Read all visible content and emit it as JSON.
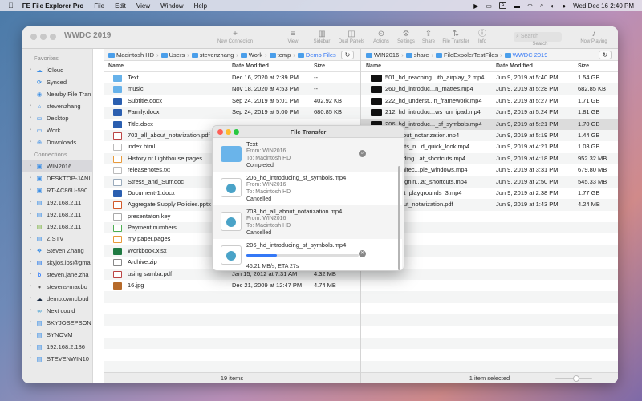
{
  "menubar": {
    "apple": "",
    "items": [
      "FE File Explorer Pro",
      "File",
      "Edit",
      "View",
      "Window",
      "Help"
    ],
    "input_badge": "A",
    "clock": "Wed Dec 16  2:40 PM"
  },
  "window": {
    "title": "WWDC 2019",
    "toolbar": [
      {
        "icon": "+",
        "label": "New Connection"
      },
      {
        "icon": "≡",
        "label": "View"
      },
      {
        "icon": "▥",
        "label": "Sidebar"
      },
      {
        "icon": "◫",
        "label": "Dual Panels"
      },
      {
        "icon": "⊙",
        "label": "Actions"
      },
      {
        "icon": "⚙",
        "label": "Settings"
      },
      {
        "icon": "⇪",
        "label": "Share"
      },
      {
        "icon": "⇅",
        "label": "File Transfer"
      },
      {
        "icon": "ⓘ",
        "label": "Info"
      },
      {
        "icon": "⌕",
        "label": "Search"
      },
      {
        "icon": "♪",
        "label": "Now Playing"
      }
    ],
    "search_placeholder": "Search"
  },
  "sidebar": {
    "favorites_header": "Favorites",
    "favorites": [
      {
        "label": "iCloud",
        "icon": "☁",
        "color": "#3a8ee6",
        "arrow": true
      },
      {
        "label": "Synced",
        "icon": "⟳",
        "color": "#3a8ee6",
        "arrow": false
      },
      {
        "label": "Nearby File Tran",
        "icon": "◉",
        "color": "#3a8ee6",
        "arrow": false
      },
      {
        "label": "stevenzhang",
        "icon": "⌂",
        "color": "#3a8ee6",
        "arrow": true
      },
      {
        "label": "Desktop",
        "icon": "▭",
        "color": "#3a8ee6",
        "arrow": true
      },
      {
        "label": "Work",
        "icon": "▭",
        "color": "#3a8ee6",
        "arrow": true
      },
      {
        "label": "Downloads",
        "icon": "⊕",
        "color": "#3a8ee6",
        "arrow": true
      }
    ],
    "connections_header": "Connections",
    "connections": [
      {
        "label": "WIN2016",
        "icon": "▣",
        "color": "#3a8ee6",
        "selected": true
      },
      {
        "label": "DESKTOP-JANI",
        "icon": "▣",
        "color": "#3a8ee6"
      },
      {
        "label": "RT-AC86U-590",
        "icon": "▣",
        "color": "#3a8ee6"
      },
      {
        "label": "192.168.2.11",
        "icon": "▤",
        "color": "#3a8ee6"
      },
      {
        "label": "192.168.2.11",
        "icon": "▤",
        "color": "#3a8ee6"
      },
      {
        "label": "192.168.2.11",
        "icon": "▤",
        "color": "#7cb342"
      },
      {
        "label": "Z STV",
        "icon": "▤",
        "color": "#3a8ee6"
      },
      {
        "label": "Steven Zhang",
        "icon": "❖",
        "color": "#3a8ee6"
      },
      {
        "label": "skyjos.ios@gma",
        "icon": "▤",
        "color": "#1a73e8"
      },
      {
        "label": "steven.jane.zha",
        "icon": "b",
        "color": "#0061fe"
      },
      {
        "label": "stevens-macbo",
        "icon": "●",
        "color": "#555"
      },
      {
        "label": "demo.owncloud",
        "icon": "☁",
        "color": "#1d2d44"
      },
      {
        "label": "Next could",
        "icon": "∞",
        "color": "#0082c9"
      },
      {
        "label": "SKYJOSEPSON",
        "icon": "▤",
        "color": "#3a8ee6"
      },
      {
        "label": "SYNOVM",
        "icon": "▤",
        "color": "#3a8ee6"
      },
      {
        "label": "192.168.2.186",
        "icon": "▤",
        "color": "#3a8ee6"
      },
      {
        "label": "STEVENWIN10",
        "icon": "▤",
        "color": "#3a8ee6"
      }
    ]
  },
  "left_pane": {
    "breadcrumb": [
      "Macintosh HD",
      "Users",
      "stevenzhang",
      "Work",
      "temp",
      "Demo Files"
    ],
    "columns": {
      "name": "Name",
      "date": "Date Modified",
      "size": "Size"
    },
    "rows": [
      {
        "name": "Text",
        "date": "Dec 16, 2020 at 2:39 PM",
        "size": "--",
        "icon": "folder"
      },
      {
        "name": "music",
        "date": "Nov 18, 2020 at 4:53 PM",
        "size": "--",
        "icon": "folder"
      },
      {
        "name": "Subtitle.docx",
        "date": "Sep 24, 2019 at 5:01 PM",
        "size": "402.92 KB",
        "icon": "word"
      },
      {
        "name": "Family.docx",
        "date": "Sep 24, 2019 at 5:00 PM",
        "size": "680.85 KB",
        "icon": "word"
      },
      {
        "name": "Title.docx",
        "date": "",
        "size": "",
        "icon": "word"
      },
      {
        "name": "703_all_about_notarization.pdf",
        "date": "",
        "size": "",
        "icon": "pdf"
      },
      {
        "name": "index.html",
        "date": "",
        "size": "",
        "icon": "gen"
      },
      {
        "name": "History of Lighthouse.pages",
        "date": "",
        "size": "",
        "icon": "pages"
      },
      {
        "name": "releasenotes.txt",
        "date": "",
        "size": "",
        "icon": "gen"
      },
      {
        "name": "Stress_and_Surr.doc",
        "date": "",
        "size": "",
        "icon": "doc"
      },
      {
        "name": "Document-1.docx",
        "date": "",
        "size": "",
        "icon": "word"
      },
      {
        "name": "Aggregate Supply Policies.pptx",
        "date": "",
        "size": "",
        "icon": "pptx"
      },
      {
        "name": "presentaton.key",
        "date": "",
        "size": "",
        "icon": "key"
      },
      {
        "name": "Payment.numbers",
        "date": "",
        "size": "",
        "icon": "num"
      },
      {
        "name": "my paper.pages",
        "date": "",
        "size": "",
        "icon": "pages"
      },
      {
        "name": "Workbook.xlsx",
        "date": "",
        "size": "",
        "icon": "excel"
      },
      {
        "name": "Archive.zip",
        "date": "",
        "size": "",
        "icon": "zip"
      },
      {
        "name": "using samba.pdf",
        "date": "Jan 15, 2012 at 7:31 AM",
        "size": "4.32 MB",
        "icon": "pdf"
      },
      {
        "name": "16.jpg",
        "date": "Dec 21, 2009 at 12:47 PM",
        "size": "4.74 MB",
        "icon": "img"
      }
    ],
    "status": "19 items"
  },
  "right_pane": {
    "breadcrumb": [
      "WIN2016",
      "share",
      "FileExpolerTestFiles",
      "WWDC 2019"
    ],
    "columns": {
      "name": "Name",
      "date": "Date Modified",
      "size": "Size"
    },
    "rows": [
      {
        "name": "501_hd_reaching...ith_airplay_2.mp4",
        "date": "Jun 9, 2019 at 5:40 PM",
        "size": "1.54 GB",
        "icon": "vid"
      },
      {
        "name": "260_hd_introduc...n_mattes.mp4",
        "date": "Jun 9, 2019 at 5:28 PM",
        "size": "682.85 KB",
        "icon": "vid"
      },
      {
        "name": "222_hd_underst...n_framework.mp4",
        "date": "Jun 9, 2019 at 5:27 PM",
        "size": "1.71 GB",
        "icon": "vid"
      },
      {
        "name": "212_hd_introduc...ws_on_ipad.mp4",
        "date": "Jun 9, 2019 at 5:24 PM",
        "size": "1.81 GB",
        "icon": "vid"
      },
      {
        "name": "206_hd_introduc..._sf_symbols.mp4",
        "date": "Jun 9, 2019 at 5:21 PM",
        "size": "1.70 GB",
        "icon": "vid",
        "selected": true
      },
      {
        "name": "...ll_about_notarization.mp4",
        "date": "Jun 9, 2019 at 5:19 PM",
        "size": "1.44 GB",
        "icon": "vid"
      },
      {
        "name": "..._whats_n...d_quick_look.mp4",
        "date": "Jun 9, 2019 at 4:21 PM",
        "size": "1.03 GB",
        "icon": "vid"
      },
      {
        "name": "..._building...at_shortcuts.mp4",
        "date": "Jun 9, 2019 at 4:18 PM",
        "size": "952.32 MB",
        "icon": "vid"
      },
      {
        "name": "..._architec...ple_windows.mp4",
        "date": "Jun 9, 2019 at 3:31 PM",
        "size": "679.80 MB",
        "icon": "vid"
      },
      {
        "name": "..._designin...at_shortcuts.mp4",
        "date": "Jun 9, 2019 at 2:50 PM",
        "size": "545.33 MB",
        "icon": "vid"
      },
      {
        "name": "..._swift_playgrounds_3.mp4",
        "date": "Jun 9, 2019 at 2:38 PM",
        "size": "1.77 GB",
        "icon": "vid"
      },
      {
        "name": "..._about_notarization.pdf",
        "date": "Jun 9, 2019 at 1:43 PM",
        "size": "4.24 MB",
        "icon": "pdf"
      }
    ],
    "status": "1 item selected"
  },
  "transfer": {
    "title": "File Transfer",
    "items": [
      {
        "name": "Text",
        "from": "From: WIN2016",
        "to": "To: Macintosh HD",
        "status": "Completed",
        "kind": "folder",
        "action": "⌕"
      },
      {
        "name": "206_hd_introducing_sf_symbols.mp4",
        "from": "From: WIN2016",
        "to": "To: Macintosh HD",
        "status": "Cancelled",
        "kind": "file",
        "action": ""
      },
      {
        "name": "703_hd_all_about_notarization.mp4",
        "from": "From: WIN2016",
        "to": "To: Macintosh HD",
        "status": "Cancelled",
        "kind": "file",
        "action": ""
      },
      {
        "name": "206_hd_introducing_sf_symbols.mp4",
        "from": "",
        "to": "",
        "status": "46.21 MB/s, ETA 27s",
        "kind": "file",
        "action": "✕",
        "progress": 0.27
      }
    ]
  }
}
